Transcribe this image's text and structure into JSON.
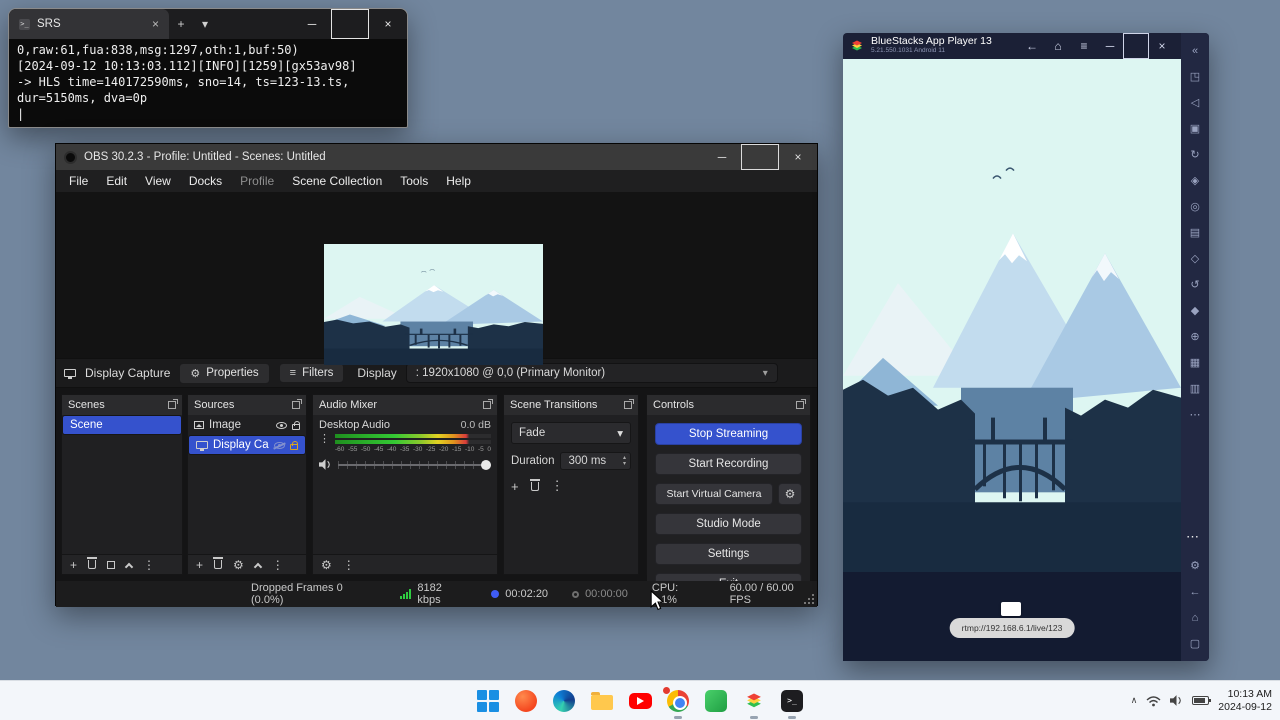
{
  "icons": {
    "close": "×",
    "minimize": "─",
    "plus": "+",
    "tab_chevron": "▾",
    "select_chevron": "▾",
    "spin_up": "▴",
    "spin_down": "▾",
    "kebab": "⋮",
    "ellipsis": "⋯",
    "gear": "⚙",
    "filter": "≡",
    "back": "←",
    "home": "⌂",
    "menu": "≡",
    "caret": "|",
    "tray_chevron": "∧",
    "prompt": ">_"
  },
  "terminal": {
    "tab_title": "SRS",
    "lines": [
      "0,raw:61,fua:838,msg:1297,oth:1,buf:50)",
      "[2024-09-12 10:13:03.112][INFO][1259][gx53av98]",
      "-> HLS time=140172590ms, sno=14, ts=123-13.ts,",
      "dur=5150ms, dva=0p"
    ],
    "caret": "|"
  },
  "obs": {
    "title": "OBS 30.2.3 - Profile: Untitled - Scenes: Untitled",
    "menu_items": [
      "File",
      "Edit",
      "View",
      "Docks",
      "Profile",
      "Scene Collection",
      "Tools",
      "Help"
    ],
    "source_toolbar": {
      "source_label": "Display Capture",
      "properties": "Properties",
      "filters": "Filters",
      "display_label": "Display",
      "display_value": ": 1920x1080 @ 0,0 (Primary Monitor)"
    },
    "scenes": {
      "title": "Scenes",
      "items": [
        "Scene"
      ]
    },
    "sources": {
      "title": "Sources",
      "items": [
        "Image",
        "Display Ca"
      ]
    },
    "mixer": {
      "title": "Audio Mixer",
      "channel": "Desktop Audio",
      "level": "0.0 dB",
      "ticks": [
        "-60",
        "-55",
        "-50",
        "-45",
        "-40",
        "-35",
        "-30",
        "-25",
        "-20",
        "-15",
        "-10",
        "-5",
        "0"
      ]
    },
    "transitions": {
      "title": "Scene Transitions",
      "value": "Fade",
      "duration_label": "Duration",
      "duration_value": "300 ms"
    },
    "controls": {
      "title": "Controls",
      "buttons": [
        "Stop Streaming",
        "Start Recording",
        "Start Virtual Camera",
        "Studio Mode",
        "Settings",
        "Exit"
      ]
    },
    "status": {
      "dropped": "Dropped Frames 0 (0.0%)",
      "bitrate": "8182 kbps",
      "stream_time": "00:02:20",
      "rec_time": "00:00:00",
      "cpu": "CPU: 5.1%",
      "fps": "60.00 / 60.00 FPS"
    }
  },
  "bluestacks": {
    "title": "BlueStacks App Player 13",
    "subtitle": "5.21.550.1031 Android 11",
    "tooltip": "rtmp://192.168.6.1/live/123",
    "sidebar_icons": [
      {
        "name": "collapse-sidebar",
        "glyph": "«"
      },
      {
        "name": "fullscreen",
        "glyph": "◳"
      },
      {
        "name": "volume",
        "glyph": "◁"
      },
      {
        "name": "screenshot",
        "glyph": "▣"
      },
      {
        "name": "rotate",
        "glyph": "↻"
      },
      {
        "name": "shake",
        "glyph": "◈"
      },
      {
        "name": "location",
        "glyph": "◎"
      },
      {
        "name": "keymap",
        "glyph": "▤"
      },
      {
        "name": "macro-recorder",
        "glyph": "◇"
      },
      {
        "name": "sync",
        "glyph": "↺"
      },
      {
        "name": "eco-mode",
        "glyph": "◆"
      },
      {
        "name": "screen-zoom",
        "glyph": "⊕"
      },
      {
        "name": "gamepad",
        "glyph": "▦"
      },
      {
        "name": "media-manager",
        "glyph": "▥"
      },
      {
        "name": "more-tools",
        "glyph": "⋯"
      },
      {
        "name": "settings",
        "glyph": "⚙"
      },
      {
        "name": "nav-back",
        "glyph": "←"
      },
      {
        "name": "nav-home",
        "glyph": "⌂"
      },
      {
        "name": "nav-recent",
        "glyph": "▢"
      }
    ]
  },
  "taskbar": {
    "time": "10:13 AM",
    "date": "2024-09-12",
    "apps": [
      "start",
      "brave",
      "edge",
      "file-explorer",
      "youtube",
      "chrome",
      "android-app",
      "bluestacks",
      "terminal"
    ]
  }
}
